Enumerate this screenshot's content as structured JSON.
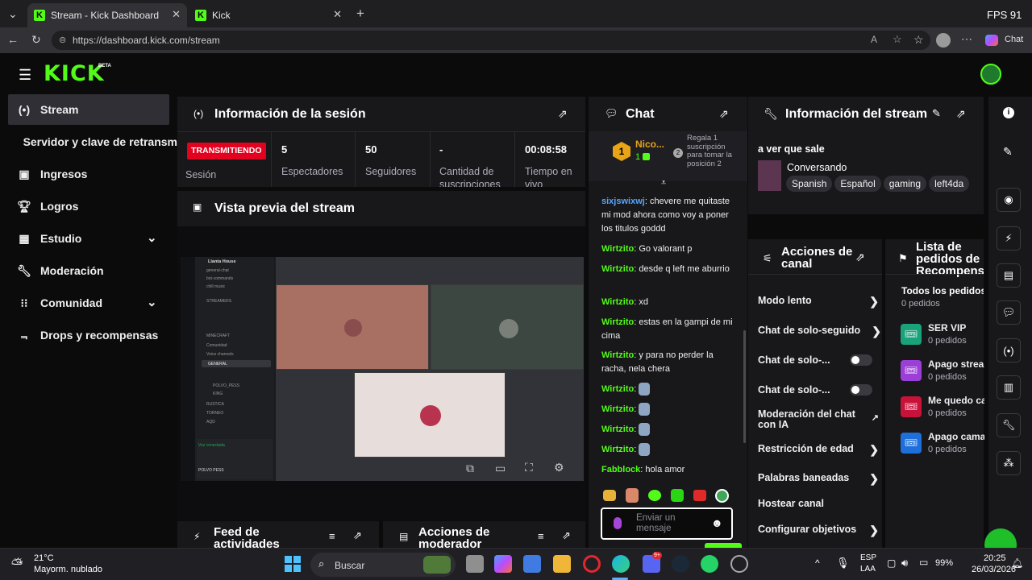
{
  "browser": {
    "fps": "FPS 91",
    "tabs": [
      {
        "title": "Stream - Kick Dashboard",
        "active": true
      },
      {
        "title": "Kick",
        "active": false
      }
    ],
    "url": "https://dashboard.kick.com/stream",
    "chat_button": "Chat",
    "favicon_letter": "K"
  },
  "header": {
    "logo": "KICK",
    "logo_badge": "BETA"
  },
  "sidebar": {
    "items": [
      {
        "label": "Stream",
        "icon": "broadcast-icon",
        "active": true
      },
      {
        "label": "Servidor y clave de retransm",
        "icon": "",
        "active": false
      },
      {
        "label": "Ingresos",
        "icon": "money-icon",
        "active": false
      },
      {
        "label": "Logros",
        "icon": "trophy-icon",
        "active": false
      },
      {
        "label": "Estudio",
        "icon": "studio-icon",
        "active": false,
        "expandable": true
      },
      {
        "label": "Moderación",
        "icon": "wrench-icon",
        "active": false
      },
      {
        "label": "Comunidad",
        "icon": "community-icon",
        "active": false,
        "expandable": true
      },
      {
        "label": "Drops y recompensas",
        "icon": "drops-icon",
        "active": false
      }
    ]
  },
  "session": {
    "title": "Información de la sesión",
    "status_badge": "TRANSMITIENDO",
    "status_label": "Sesión",
    "stats": [
      {
        "value": "5",
        "label": "Espectadores"
      },
      {
        "value": "50",
        "label": "Seguidores"
      },
      {
        "value": "-",
        "label": "Cantidad de suscripciones"
      },
      {
        "value": "00:08:58",
        "label": "Tiempo en vivo"
      }
    ]
  },
  "preview": {
    "title": "Vista previa del stream",
    "discord_server": "Llanta House",
    "discord_channels": [
      "general-chat",
      "bot-commands",
      "chill music",
      "STREAMERS",
      "MINECRAFT",
      "Comunidad",
      "Voice channels",
      "GENERAL",
      "POLVO_PESS",
      "KING",
      "RUSTICA",
      "TORNEO",
      "AQD"
    ],
    "voice_status": "Voz conectada",
    "user_name": "POLVO PESS"
  },
  "feed": {
    "title": "Feed de actividades"
  },
  "modactions": {
    "title": "Acciones de moderador"
  },
  "chat": {
    "title": "Chat",
    "pinned_name": "Nico...",
    "pinned_rank": "1",
    "pinned_count": "1",
    "pinned_note": "Regala 1 suscripción para tomar la posición 2",
    "messages": [
      {
        "user": "sixjswixwj",
        "text": "chevere me quitaste mi mod ahora como voy a poner los titulos goddd",
        "color": "#57a6ff"
      },
      {
        "user": "Wirtzito",
        "text": "Go valorant p",
        "color": "#53fc18"
      },
      {
        "user": "Wirtzito",
        "text": "desde q left me aburrio",
        "color": "#53fc18"
      },
      {
        "user": "Wirtzito",
        "text": "xd",
        "color": "#53fc18"
      },
      {
        "user": "Wirtzito",
        "text": "estas en la gampi de mi cima",
        "color": "#53fc18"
      },
      {
        "user": "Wirtzito",
        "text": "y para no perder la racha, nela chera",
        "color": "#53fc18"
      },
      {
        "user": "Wirtzito",
        "text": "",
        "color": "#53fc18"
      },
      {
        "user": "Wirtzito",
        "text": "",
        "color": "#53fc18"
      },
      {
        "user": "Wirtzito",
        "text": "",
        "color": "#53fc18"
      },
      {
        "user": "Wirtzito",
        "text": "",
        "color": "#53fc18"
      },
      {
        "user": "Fabblock",
        "text": "hola amor",
        "color": "#53fc18"
      }
    ],
    "input_placeholder": "Enviar un mensaje"
  },
  "stream_info": {
    "title": "Información del stream",
    "stream_title": "a ver que sale",
    "category": "Conversando",
    "tags": [
      "Spanish",
      "Español",
      "gaming",
      "left4da"
    ]
  },
  "channel_actions": {
    "title": "Acciones de canal",
    "items": [
      {
        "label": "Modo lento",
        "control": "chevron"
      },
      {
        "label": "Chat de solo-seguido",
        "control": "chevron"
      },
      {
        "label": "Chat de solo-...",
        "control": "toggle"
      },
      {
        "label": "Chat de solo-...",
        "control": "toggle"
      },
      {
        "label": "Moderación del chat con IA",
        "control": "external"
      },
      {
        "label": "Restricción de edad",
        "control": "chevron"
      },
      {
        "label": "Palabras baneadas",
        "control": "chevron"
      },
      {
        "label": "Hostear canal",
        "control": "none"
      },
      {
        "label": "Configurar objetivos",
        "control": "chevron"
      }
    ]
  },
  "rewards": {
    "title": "Lista de pedidos de Recompens",
    "all_label": "Todos los pedidos",
    "all_count": "0 pedidos",
    "items": [
      {
        "title": "SER VIP",
        "count": "0 pedidos",
        "color": "#1aa37a"
      },
      {
        "title": "Apago strea",
        "count": "0 pedidos",
        "color": "#9b3fd6"
      },
      {
        "title": "Me quedo ca",
        "count": "0 pedidos",
        "color": "#c8123a"
      },
      {
        "title": "Apago cama",
        "count": "0 pedidos",
        "color": "#1e6fd9"
      }
    ]
  },
  "taskbar": {
    "weather_temp": "21°C",
    "weather_desc": "Mayorm. nublado",
    "search": "Buscar",
    "lang": "ESP",
    "lang2": "LAA",
    "battery": "99%",
    "time": "20:25",
    "date": "26/03/2026",
    "discord_badge": "9+"
  },
  "colors": {
    "kick_green": "#53fc18",
    "live_red": "#e2011e"
  }
}
